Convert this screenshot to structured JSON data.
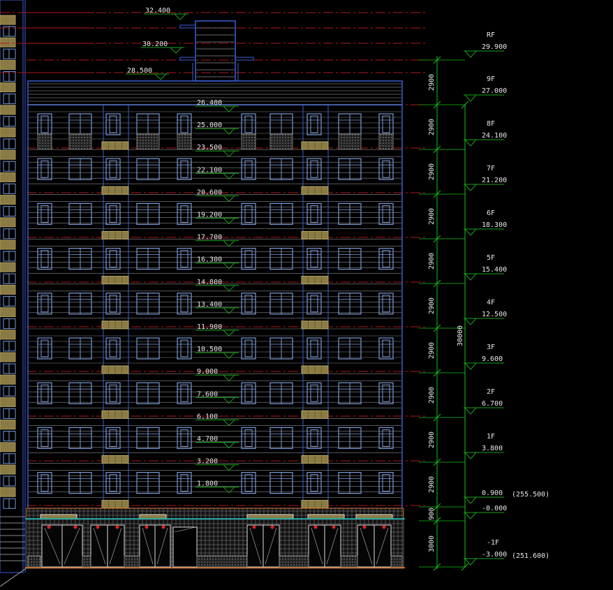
{
  "colors": {
    "background": "#000000",
    "facade": "#3a5fcf",
    "window": "#7a9ad8",
    "hatch": "#6f6f6f",
    "level_line": "#b0181c",
    "marker": "#19a319",
    "dim": "#19c119",
    "text": "#e8e8e8",
    "planter": "#8a7a44",
    "base": "#d2691e"
  },
  "elevation_marks": [
    "32.400",
    "30.200",
    "28.500",
    "26.400",
    "25.000",
    "23.500",
    "22.100",
    "20.600",
    "19.200",
    "17.700",
    "16.300",
    "14.800",
    "13.400",
    "11.900",
    "10.500",
    "9.000",
    "7.600",
    "6.100",
    "4.700",
    "3.200",
    "1.800"
  ],
  "right_levels": [
    {
      "value": "29.900",
      "floor": "RF"
    },
    {
      "value": "27.000",
      "floor": "9F"
    },
    {
      "value": "24.100",
      "floor": "8F"
    },
    {
      "value": "21.200",
      "floor": "7F"
    },
    {
      "value": "18.300",
      "floor": "6F"
    },
    {
      "value": "15.400",
      "floor": "5F"
    },
    {
      "value": "12.500",
      "floor": "4F"
    },
    {
      "value": "9.600",
      "floor": "3F"
    },
    {
      "value": "6.700",
      "floor": "2F"
    },
    {
      "value": "3.800",
      "floor": "1F"
    },
    {
      "value": "0.900",
      "floor": ""
    },
    {
      "value": "-0.000",
      "floor": ""
    },
    {
      "value": "-3.000",
      "floor": "-1F"
    }
  ],
  "absolute_levels": [
    "(255.500)",
    "(251.600)"
  ],
  "dimensions": [
    "2900",
    "2900",
    "2900",
    "2900",
    "2900",
    "2900",
    "2900",
    "2900",
    "2900",
    "2900",
    "900",
    "3000"
  ],
  "total_dimension": "30000"
}
